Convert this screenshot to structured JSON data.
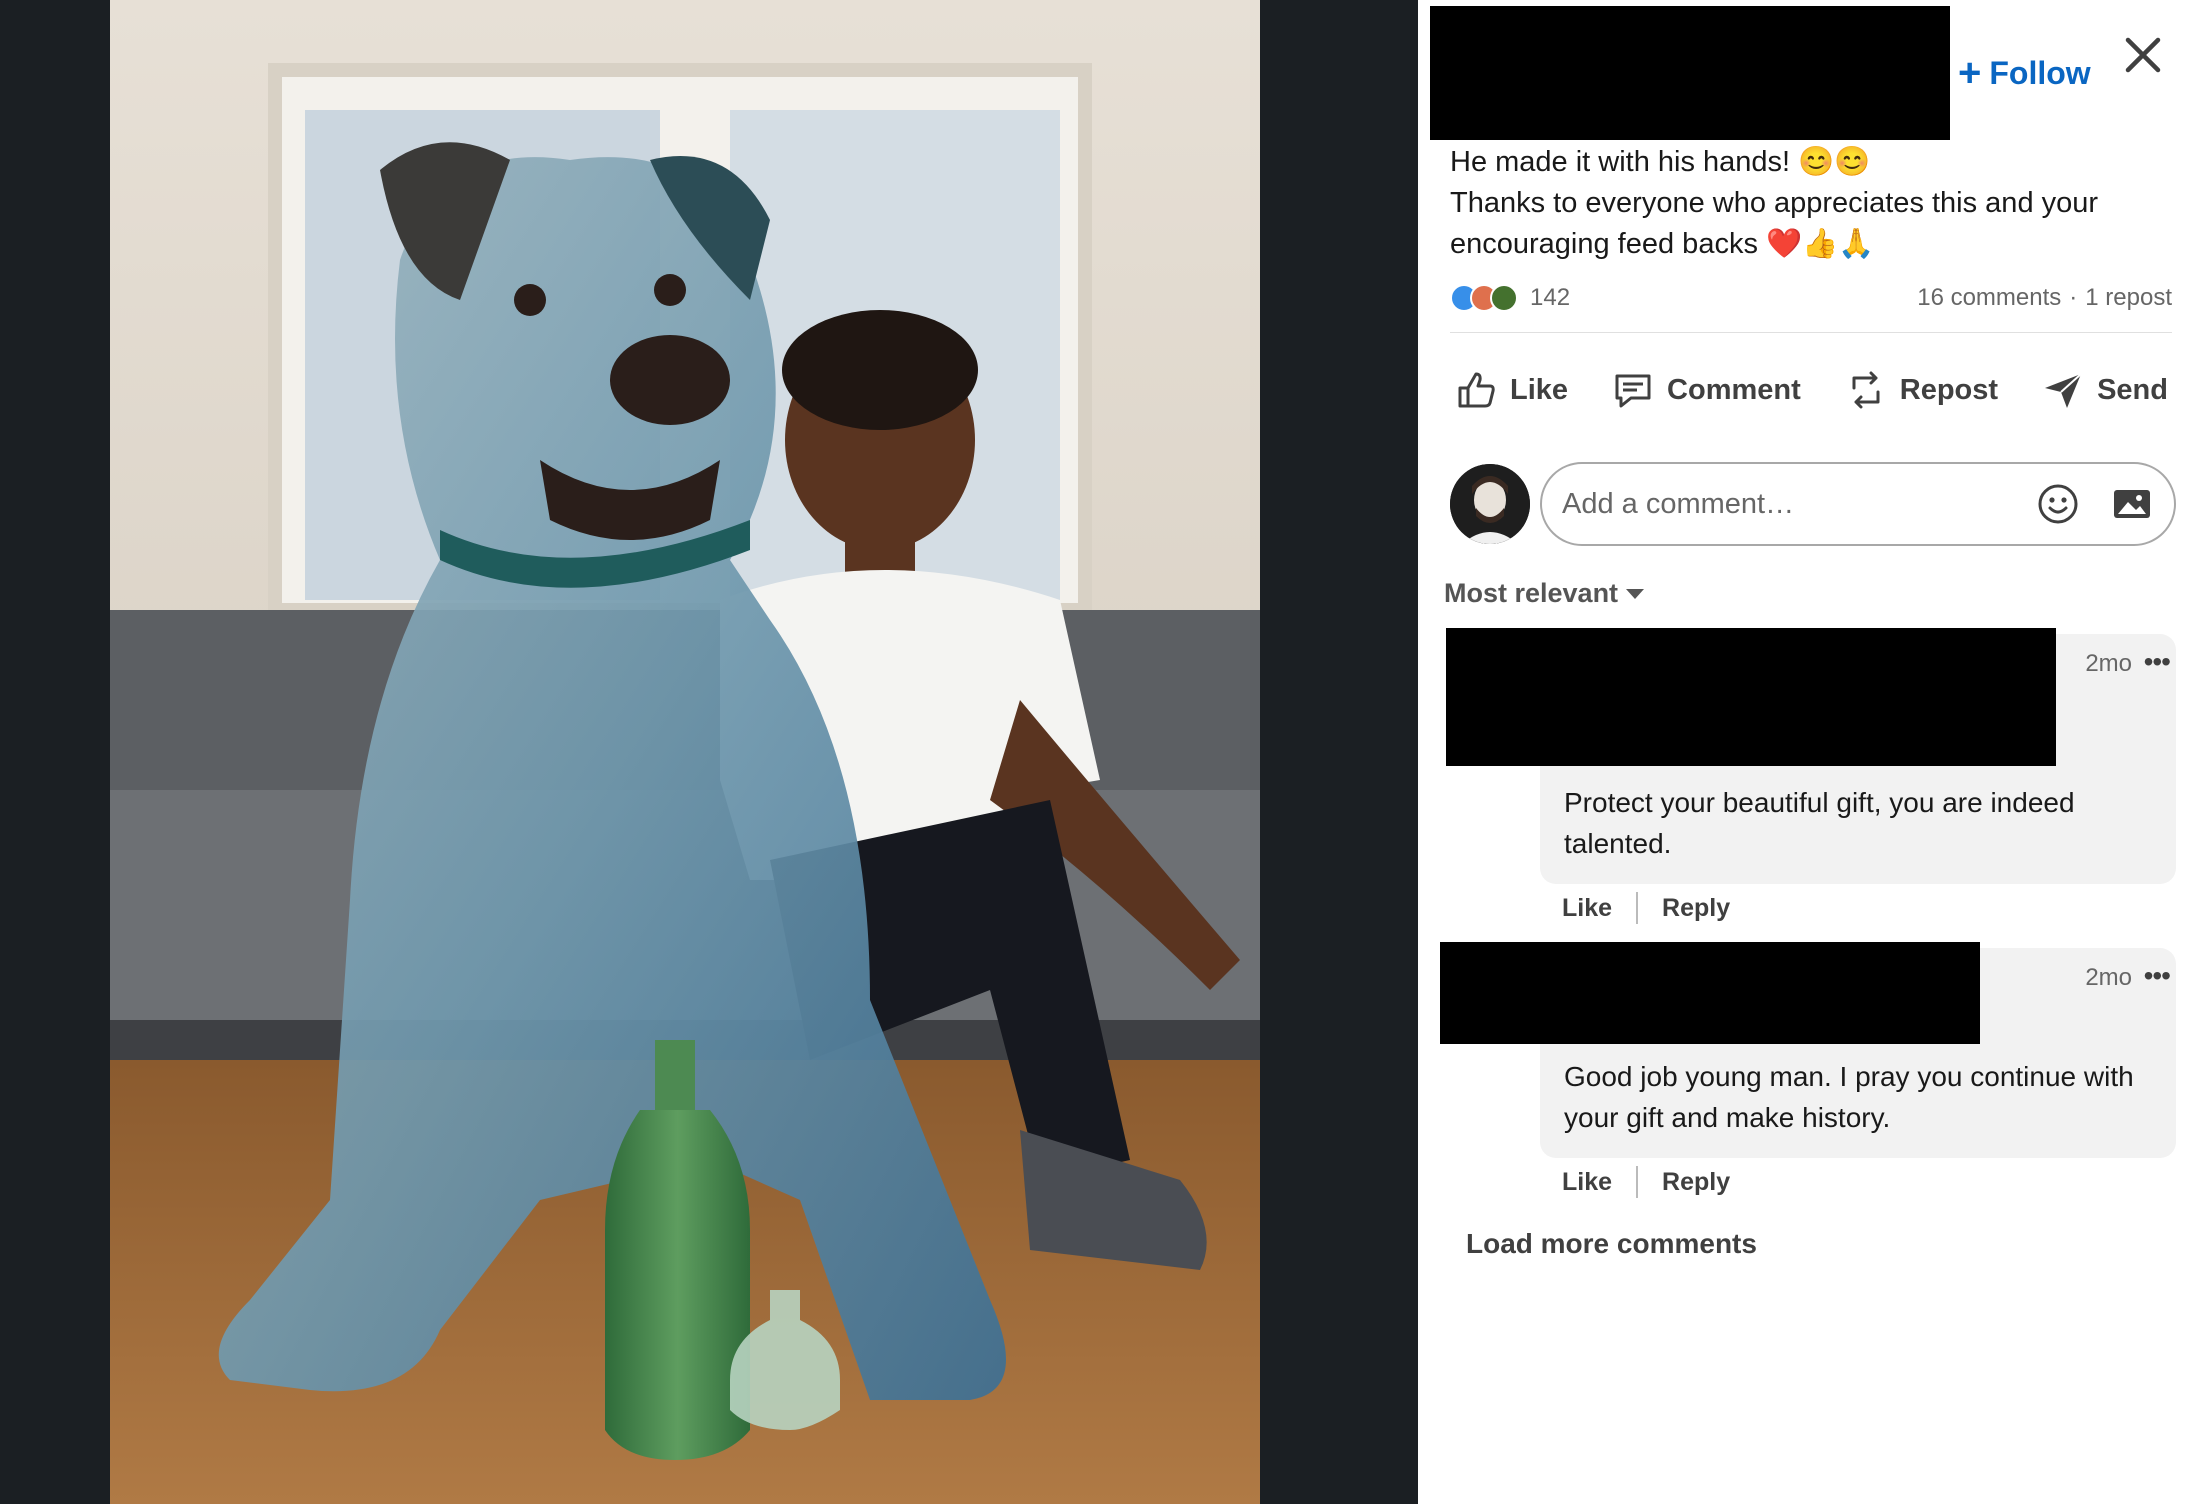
{
  "header": {
    "follow_label": "Follow",
    "close_icon": "close-icon"
  },
  "post": {
    "line1": "He made it with his hands! 😊😊",
    "line2": "Thanks to everyone who appreciates this and your encouraging feed backs ❤️👍🙏"
  },
  "social": {
    "reaction_count": "142",
    "comments_count": "16 comments",
    "separator": "·",
    "repost_count": "1 repost"
  },
  "actions": {
    "like": "Like",
    "comment": "Comment",
    "repost": "Repost",
    "send": "Send"
  },
  "comment_input": {
    "placeholder": "Add a comment…"
  },
  "sort": {
    "label": "Most relevant"
  },
  "comments": [
    {
      "time": "2mo",
      "more": "•••",
      "text": "Protect your beautiful gift, you are indeed talented.",
      "like": "Like",
      "reply": "Reply"
    },
    {
      "time": "2mo",
      "more": "•••",
      "text": "Good job young man. I pray you continue with your gift and make history.",
      "like": "Like",
      "reply": "Reply"
    }
  ],
  "load_more": "Load more comments",
  "colors": {
    "follow_blue": "#0a66c2",
    "page_dark": "#1b1f23",
    "bubble_bg": "#f2f2f2"
  }
}
